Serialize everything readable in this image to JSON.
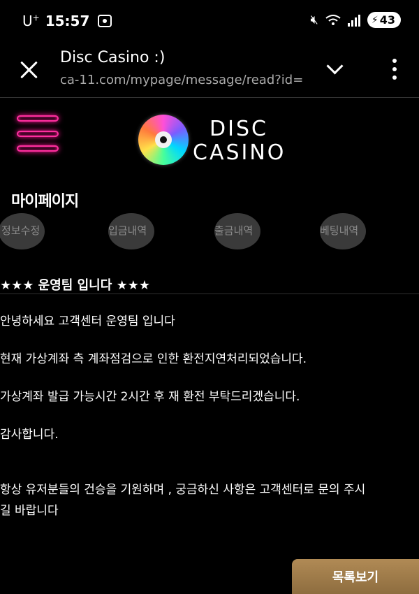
{
  "status_bar": {
    "carrier": "U",
    "carrier_sup": "+",
    "time": "15:57",
    "battery": "43"
  },
  "browser": {
    "title": "Disc Casino :)",
    "url": "ca-11.com/mypage/message/read?id="
  },
  "site": {
    "brand_line1": "DISC",
    "brand_line2": "CASINO",
    "accent_color": "#ff2fa0"
  },
  "mypage": {
    "title": "마이페이지",
    "tabs": [
      {
        "label": "정보수정"
      },
      {
        "label": "입금내역"
      },
      {
        "label": "출금내역"
      },
      {
        "label": "베팅내역"
      }
    ]
  },
  "message": {
    "subject": "★★★ 운영팀 입니다 ★★★",
    "lines": [
      "안녕하세요 고객센터 운영팀 입니다",
      "현재 가상계좌 측 계좌점검으로 인한 환전지연처리되었습니다.",
      "가상계좌 발급 가능시간 2시간 후 재 환전 부탁드리겠습니다.",
      "감사합니다.",
      "항상 유저분들의 건승을 기원하며 , 궁금하신 사항은 고객센터로 문의 주시",
      "길 바랍니다"
    ]
  },
  "actions": {
    "list_label": "목록보기"
  }
}
